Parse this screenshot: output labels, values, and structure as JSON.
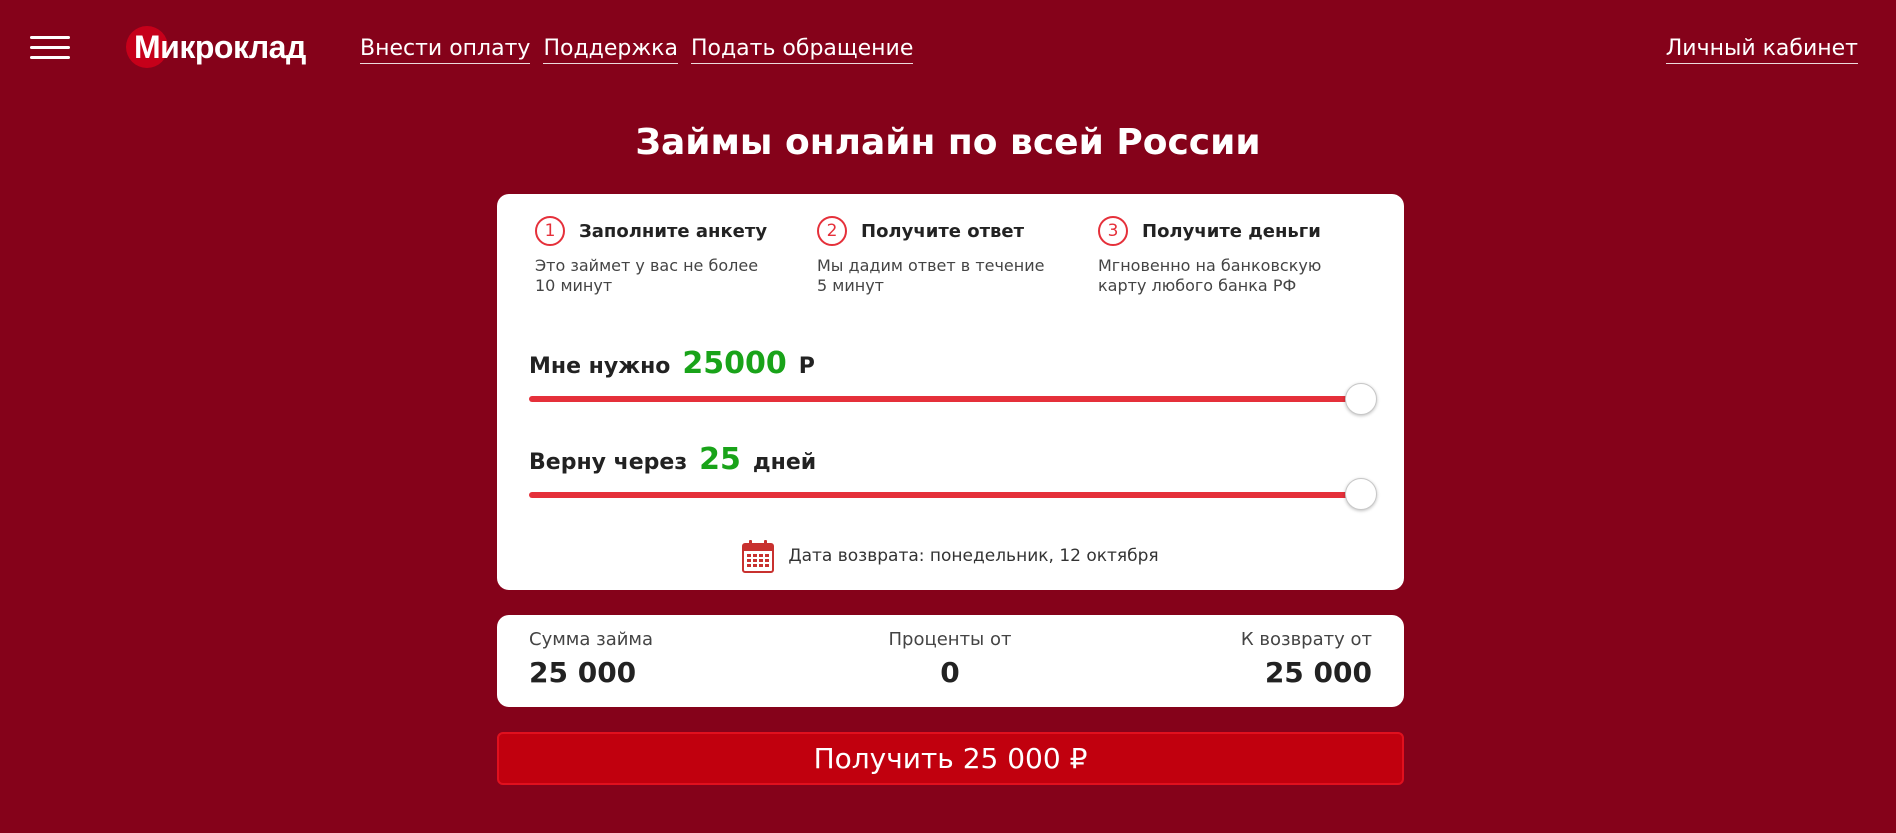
{
  "header": {
    "logo_text": "Микроклад",
    "nav": [
      {
        "label": "Внести оплату"
      },
      {
        "label": "Поддержка"
      },
      {
        "label": "Подать обращение"
      }
    ],
    "cabinet_label": "Личный кабинет"
  },
  "title": "Займы онлайн по всей России",
  "steps": [
    {
      "num": "1",
      "title": "Заполните анкету",
      "desc": "Это займет у вас не более 10 минут"
    },
    {
      "num": "2",
      "title": "Получите ответ",
      "desc": "Мы дадим ответ в течение 5 минут"
    },
    {
      "num": "3",
      "title": "Получите деньги",
      "desc": "Мгновенно на банковскую карту любого банка РФ"
    }
  ],
  "amount_slider": {
    "label": "Мне нужно",
    "value": "25000",
    "unit": "Р",
    "fill_fraction": 1.0
  },
  "term_slider": {
    "label": "Верну через",
    "value": "25",
    "unit": "дней",
    "fill_fraction": 1.0
  },
  "return_date": "Дата возврата: понедельник, 12 октября",
  "summary": {
    "loan": {
      "label": "Сумма займа",
      "value": "25 000"
    },
    "interest": {
      "label": "Проценты от",
      "value": "0"
    },
    "total": {
      "label": "К возврату от",
      "value": "25 000"
    }
  },
  "cta_label": "Получить 25 000 ₽",
  "colors": {
    "background": "#85021a",
    "accent": "#e5303a",
    "value_green": "#19a319",
    "button": "#c1000e"
  }
}
